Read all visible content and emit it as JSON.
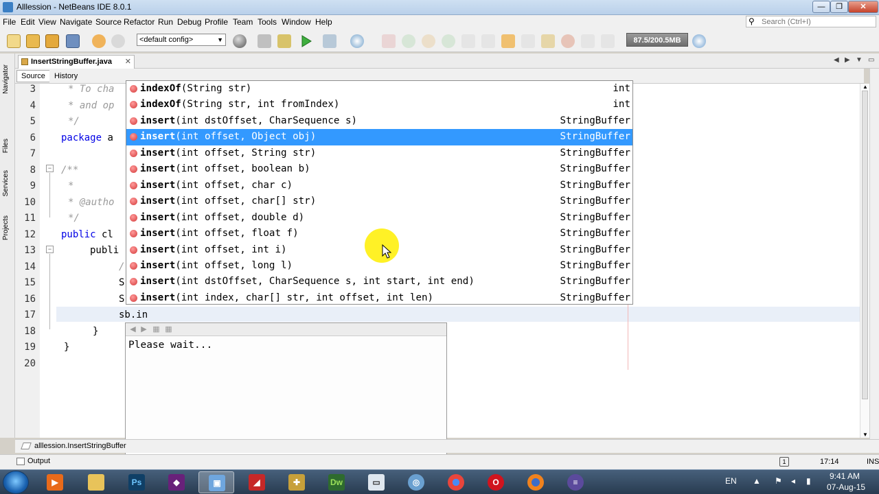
{
  "window": {
    "title": "Alllession - NetBeans IDE 8.0.1"
  },
  "menu": [
    "File",
    "Edit",
    "View",
    "Navigate",
    "Source",
    "Refactor",
    "Run",
    "Debug",
    "Profile",
    "Team",
    "Tools",
    "Window",
    "Help"
  ],
  "search": {
    "placeholder": "Search (Ctrl+I)"
  },
  "toolbar": {
    "config_value": "<default config>",
    "memory": "87.5/200.5MB"
  },
  "sidebar": {
    "tabs": [
      "Navigator",
      "Files",
      "Services",
      "Projects"
    ]
  },
  "editor": {
    "tab_label": "InsertStringBuffer.java",
    "source_label": "Source",
    "history_label": "History",
    "lines": [
      {
        "num": "3",
        "text": "* To cha"
      },
      {
        "num": "4",
        "text": "* and op"
      },
      {
        "num": "5",
        "text": "*/"
      },
      {
        "num": "6",
        "text": "package a"
      },
      {
        "num": "7",
        "text": ""
      },
      {
        "num": "8",
        "text": "/**"
      },
      {
        "num": "9",
        "text": "*"
      },
      {
        "num": "10",
        "text": "* @autho"
      },
      {
        "num": "11",
        "text": "*/"
      },
      {
        "num": "12",
        "text": "public cl"
      },
      {
        "num": "13",
        "text": "publi"
      },
      {
        "num": "14",
        "text": "/"
      },
      {
        "num": "15",
        "text": "S"
      },
      {
        "num": "16",
        "text": "S"
      },
      {
        "num": "17",
        "text": "sb.in"
      },
      {
        "num": "18",
        "text": "}"
      },
      {
        "num": "19",
        "text": "}"
      },
      {
        "num": "20",
        "text": ""
      }
    ]
  },
  "completion": {
    "items": [
      {
        "name": "indexOf",
        "sig": "(String str)",
        "ret": "int"
      },
      {
        "name": "indexOf",
        "sig": "(String str, int fromIndex)",
        "ret": "int"
      },
      {
        "name": "insert",
        "sig": "(int dstOffset, CharSequence s)",
        "ret": "StringBuffer"
      },
      {
        "name": "insert",
        "sig": "(int offset, Object obj)",
        "ret": "StringBuffer"
      },
      {
        "name": "insert",
        "sig": "(int offset, String str)",
        "ret": "StringBuffer"
      },
      {
        "name": "insert",
        "sig": "(int offset, boolean b)",
        "ret": "StringBuffer"
      },
      {
        "name": "insert",
        "sig": "(int offset, char c)",
        "ret": "StringBuffer"
      },
      {
        "name": "insert",
        "sig": "(int offset, char[] str)",
        "ret": "StringBuffer"
      },
      {
        "name": "insert",
        "sig": "(int offset, double d)",
        "ret": "StringBuffer"
      },
      {
        "name": "insert",
        "sig": "(int offset, float f)",
        "ret": "StringBuffer"
      },
      {
        "name": "insert",
        "sig": "(int offset, int i)",
        "ret": "StringBuffer"
      },
      {
        "name": "insert",
        "sig": "(int offset, long l)",
        "ret": "StringBuffer"
      },
      {
        "name": "insert",
        "sig": "(int dstOffset, CharSequence s, int start, int end)",
        "ret": "StringBuffer"
      },
      {
        "name": "insert",
        "sig": "(int index, char[] str, int offset, int len)",
        "ret": "StringBuffer"
      }
    ],
    "selected_index": 3
  },
  "javadoc": {
    "text": "Please wait..."
  },
  "breadcrumb": {
    "label": "alllession.InsertStringBuffer"
  },
  "status": {
    "output_label": "Output",
    "position": "17:14",
    "mode": "INS"
  },
  "taskbar": {
    "lang": "EN",
    "time": "9:41 AM",
    "date": "07-Aug-15"
  }
}
